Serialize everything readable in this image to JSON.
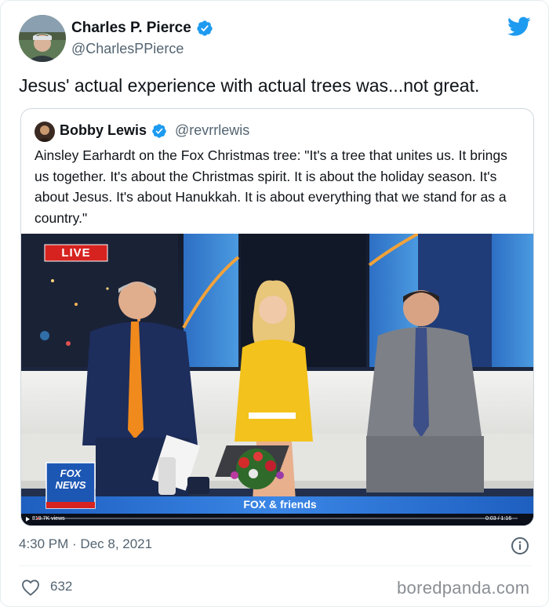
{
  "author": {
    "name": "Charles P. Pierce",
    "handle": "@CharlesPPierce"
  },
  "tweet": {
    "text": "Jesus' actual experience with actual trees was...not great."
  },
  "quoted_tweet": {
    "author_name": "Bobby Lewis",
    "author_handle": "@revrrlewis",
    "text": "Ainsley Earhardt on the Fox Christmas tree: \"It's a tree that unites us. It brings us together. It's about the Christmas spirit. It is about the holiday season. It's about Jesus. It's about Hanukkah. It is about everything that we stand for as a country.\"",
    "video": {
      "live_badge": "LIVE",
      "network_logo": "FOX NEWS",
      "show_title": "FOX & friends",
      "views": "819.7K views",
      "time": "0:03 / 1:16"
    }
  },
  "timestamp": "4:30 PM · Dec 8, 2021",
  "likes": "632",
  "watermark": "boredpanda.com",
  "colors": {
    "verified": "#1d9bf0",
    "twitter_blue": "#1d9bf0",
    "secondary_text": "#536471"
  },
  "icons": [
    "verified-badge-icon",
    "twitter-bird-icon",
    "info-icon",
    "heart-icon",
    "play-icon"
  ]
}
